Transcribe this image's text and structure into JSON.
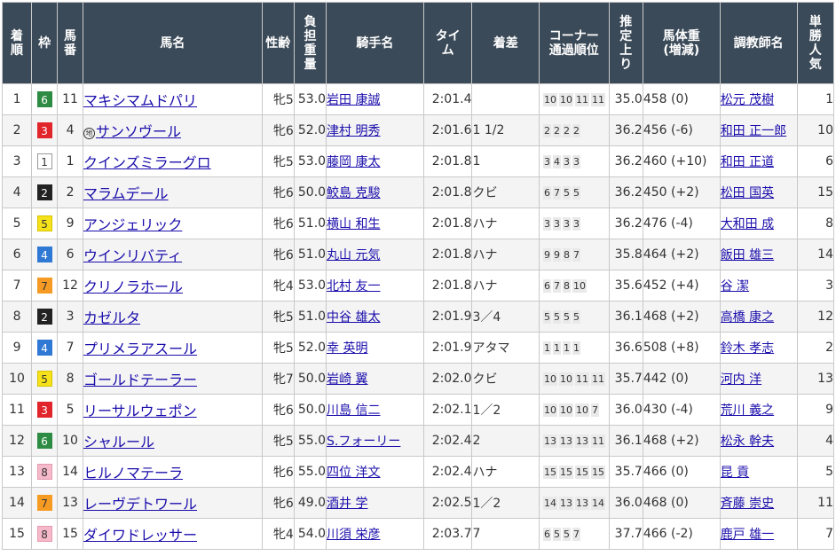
{
  "headers": {
    "rank": "着順",
    "waku": "枠",
    "num": "馬番",
    "horse": "馬名",
    "sexage": "性齢",
    "weight": "負担重量",
    "jockey": "騎手名",
    "time": "タイム",
    "margin": "着差",
    "corner_top": "コーナー",
    "corner_bottom": "通過順位",
    "last3f": "推定上り",
    "body_top": "馬体重",
    "body_bottom": "(増減)",
    "trainer": "調教師名",
    "pop": "単勝人気"
  },
  "waku_colors": {
    "1": {
      "bg": "#ffffff",
      "fg": "#333333",
      "border": "#999999"
    },
    "2": {
      "bg": "#222222",
      "fg": "#ffffff",
      "border": "#222222"
    },
    "3": {
      "bg": "#e0262b",
      "fg": "#ffffff",
      "border": "#e0262b"
    },
    "4": {
      "bg": "#2f78d4",
      "fg": "#ffffff",
      "border": "#2f78d4"
    },
    "5": {
      "bg": "#f5e21a",
      "fg": "#333333",
      "border": "#d6c400"
    },
    "6": {
      "bg": "#2e8b43",
      "fg": "#ffffff",
      "border": "#2e8b43"
    },
    "7": {
      "bg": "#f59a23",
      "fg": "#333333",
      "border": "#f59a23"
    },
    "8": {
      "bg": "#f6b9c9",
      "fg": "#333333",
      "border": "#e59ab0"
    }
  },
  "rows": [
    {
      "rank": "1",
      "waku": "6",
      "num": "11",
      "mark": "",
      "horse": "マキシマムドパリ",
      "sexage": "牝5",
      "weight": "53.0",
      "jockey": "岩田 康誠",
      "time": "2:01.4",
      "margin": "",
      "corner": [
        "10",
        "10",
        "11",
        "11"
      ],
      "last3f": "35.0",
      "body": "458 (0)",
      "trainer": "松元 茂樹",
      "pop": "1"
    },
    {
      "rank": "2",
      "waku": "3",
      "num": "4",
      "mark": "地",
      "horse": "サンソヴール",
      "sexage": "牝6",
      "weight": "52.0",
      "jockey": "津村 明秀",
      "time": "2:01.6",
      "margin": "1 1/2",
      "corner": [
        "2",
        "2",
        "2",
        "2"
      ],
      "last3f": "36.2",
      "body": "456 (-6)",
      "trainer": "和田 正一郎",
      "pop": "10"
    },
    {
      "rank": "3",
      "waku": "1",
      "num": "1",
      "mark": "",
      "horse": "クインズミラーグロ",
      "sexage": "牝5",
      "weight": "53.0",
      "jockey": "藤岡 康太",
      "time": "2:01.8",
      "margin": "1",
      "corner": [
        "3",
        "4",
        "3",
        "3"
      ],
      "last3f": "36.2",
      "body": "460 (+10)",
      "trainer": "和田 正道",
      "pop": "6"
    },
    {
      "rank": "4",
      "waku": "2",
      "num": "2",
      "mark": "",
      "horse": "マラムデール",
      "sexage": "牝6",
      "weight": "50.0",
      "jockey": "鮫島 克駿",
      "time": "2:01.8",
      "margin": "クビ",
      "corner": [
        "6",
        "7",
        "5",
        "5"
      ],
      "last3f": "36.2",
      "body": "450 (+2)",
      "trainer": "松田 国英",
      "pop": "15"
    },
    {
      "rank": "5",
      "waku": "5",
      "num": "9",
      "mark": "",
      "horse": "アンジェリック",
      "sexage": "牝6",
      "weight": "51.0",
      "jockey": "横山 和生",
      "time": "2:01.8",
      "margin": "ハナ",
      "corner": [
        "3",
        "3",
        "3",
        "3"
      ],
      "last3f": "36.2",
      "body": "476 (-4)",
      "trainer": "大和田 成",
      "pop": "8"
    },
    {
      "rank": "6",
      "waku": "4",
      "num": "6",
      "mark": "",
      "horse": "ウインリバティ",
      "sexage": "牝6",
      "weight": "51.0",
      "jockey": "丸山 元気",
      "time": "2:01.8",
      "margin": "ハナ",
      "corner": [
        "9",
        "9",
        "8",
        "7"
      ],
      "last3f": "35.8",
      "body": "464 (+2)",
      "trainer": "飯田 雄三",
      "pop": "14"
    },
    {
      "rank": "7",
      "waku": "7",
      "num": "12",
      "mark": "",
      "horse": "クリノラホール",
      "sexage": "牝4",
      "weight": "53.0",
      "jockey": "北村 友一",
      "time": "2:01.8",
      "margin": "ハナ",
      "corner": [
        "6",
        "7",
        "8",
        "10"
      ],
      "last3f": "35.6",
      "body": "452 (+4)",
      "trainer": "谷 潔",
      "pop": "3"
    },
    {
      "rank": "8",
      "waku": "2",
      "num": "3",
      "mark": "",
      "horse": "カゼルタ",
      "sexage": "牝5",
      "weight": "51.0",
      "jockey": "中谷 雄太",
      "time": "2:01.9",
      "margin": "3／4",
      "corner": [
        "5",
        "5",
        "5",
        "5"
      ],
      "last3f": "36.1",
      "body": "468 (+2)",
      "trainer": "高橋 康之",
      "pop": "12"
    },
    {
      "rank": "9",
      "waku": "4",
      "num": "7",
      "mark": "",
      "horse": "プリメラアスール",
      "sexage": "牝5",
      "weight": "52.0",
      "jockey": "幸 英明",
      "time": "2:01.9",
      "margin": "アタマ",
      "corner": [
        "1",
        "1",
        "1",
        "1"
      ],
      "last3f": "36.6",
      "body": "508 (+8)",
      "trainer": "鈴木 孝志",
      "pop": "2"
    },
    {
      "rank": "10",
      "waku": "5",
      "num": "8",
      "mark": "",
      "horse": "ゴールドテーラー",
      "sexage": "牝7",
      "weight": "50.0",
      "jockey": "岩崎 翼",
      "time": "2:02.0",
      "margin": "クビ",
      "corner": [
        "10",
        "10",
        "11",
        "11"
      ],
      "last3f": "35.7",
      "body": "442 (0)",
      "trainer": "河内 洋",
      "pop": "13"
    },
    {
      "rank": "11",
      "waku": "3",
      "num": "5",
      "mark": "",
      "horse": "リーサルウェポン",
      "sexage": "牝6",
      "weight": "50.0",
      "jockey": "川島 信二",
      "time": "2:02.1",
      "margin": "1／2",
      "corner": [
        "10",
        "10",
        "10",
        "7"
      ],
      "last3f": "36.0",
      "body": "430 (-4)",
      "trainer": "荒川 義之",
      "pop": "9"
    },
    {
      "rank": "12",
      "waku": "6",
      "num": "10",
      "mark": "",
      "horse": "シャルール",
      "sexage": "牝5",
      "weight": "55.0",
      "jockey": "S.フォーリー",
      "time": "2:02.4",
      "margin": "2",
      "corner": [
        "13",
        "13",
        "13",
        "11"
      ],
      "last3f": "36.1",
      "body": "468 (+2)",
      "trainer": "松永 幹夫",
      "pop": "4"
    },
    {
      "rank": "13",
      "waku": "8",
      "num": "14",
      "mark": "",
      "horse": "ヒルノマテーラ",
      "sexage": "牝6",
      "weight": "55.0",
      "jockey": "四位 洋文",
      "time": "2:02.4",
      "margin": "ハナ",
      "corner": [
        "15",
        "15",
        "15",
        "15"
      ],
      "last3f": "35.7",
      "body": "466 (0)",
      "trainer": "昆 貢",
      "pop": "5"
    },
    {
      "rank": "14",
      "waku": "7",
      "num": "13",
      "mark": "",
      "horse": "レーヴデトワール",
      "sexage": "牝6",
      "weight": "49.0",
      "jockey": "酒井 学",
      "time": "2:02.5",
      "margin": "1／2",
      "corner": [
        "14",
        "13",
        "13",
        "14"
      ],
      "last3f": "36.0",
      "body": "468 (0)",
      "trainer": "斉藤 崇史",
      "pop": "11"
    },
    {
      "rank": "15",
      "waku": "8",
      "num": "15",
      "mark": "",
      "horse": "ダイワドレッサー",
      "sexage": "牝4",
      "weight": "54.0",
      "jockey": "川須 栄彦",
      "time": "2:03.7",
      "margin": "7",
      "corner": [
        "6",
        "5",
        "5",
        "7"
      ],
      "last3f": "37.7",
      "body": "466 (-2)",
      "trainer": "鹿戸 雄一",
      "pop": "7"
    }
  ]
}
